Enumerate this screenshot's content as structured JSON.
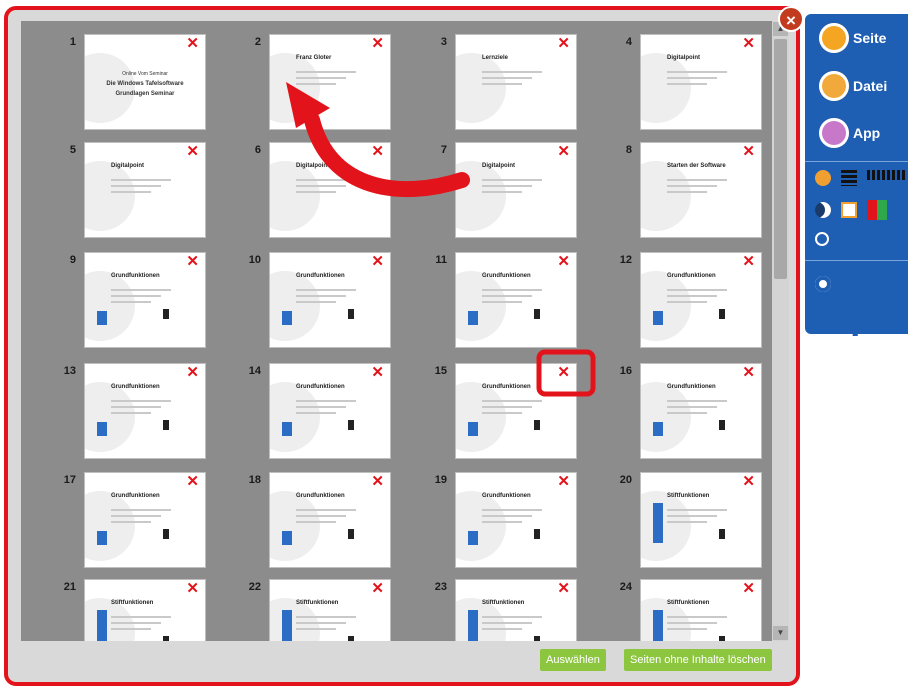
{
  "slides": [
    {
      "num": "1",
      "title": ""
    },
    {
      "num": "2",
      "title": "Franz Gloter"
    },
    {
      "num": "3",
      "title": "Lernziele"
    },
    {
      "num": "4",
      "title": "Digitalpoint"
    },
    {
      "num": "5",
      "title": "Digitalpoint"
    },
    {
      "num": "6",
      "title": "Digitalpoint"
    },
    {
      "num": "7",
      "title": "Digitalpoint"
    },
    {
      "num": "8",
      "title": "Starten der Software"
    },
    {
      "num": "9",
      "title": "Grundfunktionen"
    },
    {
      "num": "10",
      "title": "Grundfunktionen"
    },
    {
      "num": "11",
      "title": "Grundfunktionen"
    },
    {
      "num": "12",
      "title": "Grundfunktionen"
    },
    {
      "num": "13",
      "title": "Grundfunktionen"
    },
    {
      "num": "14",
      "title": "Grundfunktionen"
    },
    {
      "num": "15",
      "title": "Grundfunktionen"
    },
    {
      "num": "16",
      "title": "Grundfunktionen"
    },
    {
      "num": "17",
      "title": "Grundfunktionen"
    },
    {
      "num": "18",
      "title": "Grundfunktionen"
    },
    {
      "num": "19",
      "title": "Grundfunktionen"
    },
    {
      "num": "20",
      "title": "Stiftfunktionen"
    },
    {
      "num": "21",
      "title": "Stiftfunktionen"
    },
    {
      "num": "22",
      "title": "Stiftfunktionen"
    },
    {
      "num": "23",
      "title": "Stiftfunktionen"
    },
    {
      "num": "24",
      "title": "Stiftfunktionen"
    }
  ],
  "slide_x_icon": "✕",
  "slide1_texts": [
    "Online Vom Seminar",
    "Die Windows Tafelsoftware",
    "Grundlagen Seminar"
  ],
  "buttons": {
    "select": "Auswählen",
    "delete_empty": "Seiten ohne Inhalte löschen"
  },
  "close_icon": "×",
  "side_menu": {
    "seite": "Seite",
    "datei": "Datei",
    "app": "App"
  },
  "colors": {
    "accent_red": "#e3131b",
    "panel_blue": "#1f5fb3",
    "button_green": "#8cc63f"
  }
}
